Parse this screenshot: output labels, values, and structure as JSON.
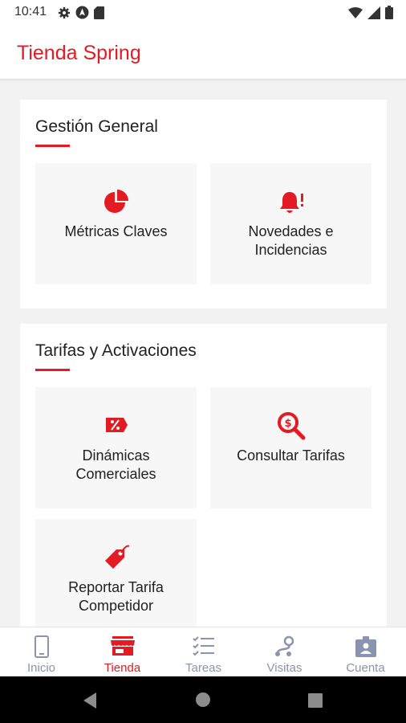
{
  "status_bar": {
    "time": "10:41",
    "left_icons": [
      "gear-icon",
      "navigation-arrow-icon",
      "sd-card-icon"
    ],
    "right_icons": [
      "wifi-icon",
      "signal-icon",
      "battery-icon"
    ]
  },
  "app_bar": {
    "title": "Tienda Spring"
  },
  "sections": [
    {
      "title": "Gestión General",
      "tiles": [
        {
          "label_lines": [
            "Métricas Claves"
          ],
          "icon": "pie-chart-icon"
        },
        {
          "label_lines": [
            "Novedades e",
            "Incidencias"
          ],
          "icon": "bell-alert-icon"
        }
      ]
    },
    {
      "title": "Tarifas y Activaciones",
      "tiles": [
        {
          "label_lines": [
            "Dinámicas",
            "Comerciales"
          ],
          "icon": "discount-ticket-icon"
        },
        {
          "label_lines": [
            "Consultar Tarifas"
          ],
          "icon": "search-dollar-icon"
        },
        {
          "label_lines": [
            "Reportar Tarifa",
            "Competidor"
          ],
          "icon": "price-tag-icon"
        }
      ]
    }
  ],
  "bottom_nav": [
    {
      "label": "Inicio",
      "icon": "phone-icon",
      "active": false
    },
    {
      "label": "Tienda",
      "icon": "store-icon",
      "active": true
    },
    {
      "label": "Tareas",
      "icon": "checklist-icon",
      "active": false
    },
    {
      "label": "Visitas",
      "icon": "route-icon",
      "active": false
    },
    {
      "label": "Cuenta",
      "icon": "id-badge-icon",
      "active": false
    }
  ],
  "colors": {
    "accent": "#e31b23",
    "nav_inactive": "#8a94b0",
    "background": "#f2f2f2",
    "tile_background": "#f7f7f7"
  }
}
